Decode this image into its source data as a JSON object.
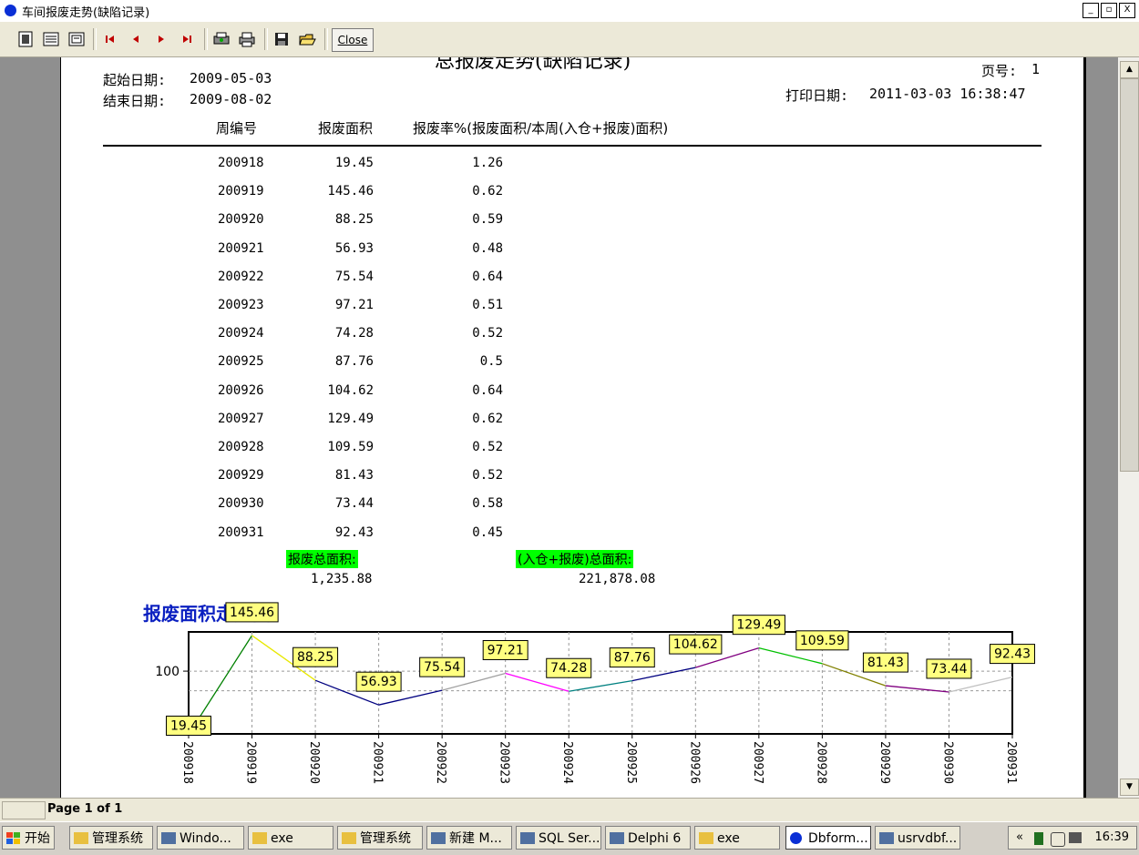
{
  "window": {
    "title": "车间报废走势(缺陷记录)",
    "minimize": "_",
    "restore": "▫",
    "close": "X"
  },
  "toolbar": {
    "close_label": "Close"
  },
  "report": {
    "title": "总报废走势(缺陷记录)",
    "start_label": "起始日期:",
    "start_value": "2009-05-03",
    "end_label": "结束日期:",
    "end_value": "2009-08-02",
    "page_label": "页号:",
    "page_value": "1",
    "print_label": "打印日期:",
    "print_value": "2011-03-03 16:38:47",
    "col_week": "周编号",
    "col_area": "报废面积",
    "col_rate": "报废率%(报废面积/本周(入仓+报废)面积)",
    "rows": [
      {
        "week": "200918",
        "area": "19.45",
        "rate": "1.26"
      },
      {
        "week": "200919",
        "area": "145.46",
        "rate": "0.62"
      },
      {
        "week": "200920",
        "area": "88.25",
        "rate": "0.59"
      },
      {
        "week": "200921",
        "area": "56.93",
        "rate": "0.48"
      },
      {
        "week": "200922",
        "area": "75.54",
        "rate": "0.64"
      },
      {
        "week": "200923",
        "area": "97.21",
        "rate": "0.51"
      },
      {
        "week": "200924",
        "area": "74.28",
        "rate": "0.52"
      },
      {
        "week": "200925",
        "area": "87.76",
        "rate": "0.5"
      },
      {
        "week": "200926",
        "area": "104.62",
        "rate": "0.64"
      },
      {
        "week": "200927",
        "area": "129.49",
        "rate": "0.62"
      },
      {
        "week": "200928",
        "area": "109.59",
        "rate": "0.52"
      },
      {
        "week": "200929",
        "area": "81.43",
        "rate": "0.52"
      },
      {
        "week": "200930",
        "area": "73.44",
        "rate": "0.58"
      },
      {
        "week": "200931",
        "area": "92.43",
        "rate": "0.45"
      }
    ],
    "total_area_label": "报废总面积:",
    "total_area_value": "1,235.88",
    "total_in_label": "(入仓+报废)总面积:",
    "total_in_value": "221,878.08",
    "chart_title": "报废面积走势图"
  },
  "chart_data": {
    "type": "line",
    "title": "报废面积走势图",
    "categories": [
      "200918",
      "200919",
      "200920",
      "200921",
      "200922",
      "200923",
      "200924",
      "200925",
      "200926",
      "200927",
      "200928",
      "200929",
      "200930",
      "200931"
    ],
    "values": [
      19.45,
      145.46,
      88.25,
      56.93,
      75.54,
      97.21,
      74.28,
      87.76,
      104.62,
      129.49,
      109.59,
      81.43,
      73.44,
      92.43
    ],
    "segment_colors": [
      "#008000",
      "#e8e800",
      "#000080",
      "#000080",
      "#a0a0a0",
      "#ff00ff",
      "#008080",
      "#000080",
      "#800080",
      "#00c000",
      "#808000",
      "#800080",
      "#c0c0c0"
    ],
    "y_ticks": [
      100
    ],
    "ylim": [
      20,
      150
    ],
    "grid": true,
    "legend": "none"
  },
  "status": {
    "page_text": "Page 1 of 1"
  },
  "taskbar": {
    "start": "开始",
    "items": [
      "管理系统",
      "Windo...",
      "exe",
      "管理系统",
      "新建 M...",
      "SQL Ser...",
      "Delphi 6",
      "exe",
      "Dbform...",
      "usrvdbf..."
    ],
    "tray_chevron": "«",
    "clock": "16:39"
  }
}
